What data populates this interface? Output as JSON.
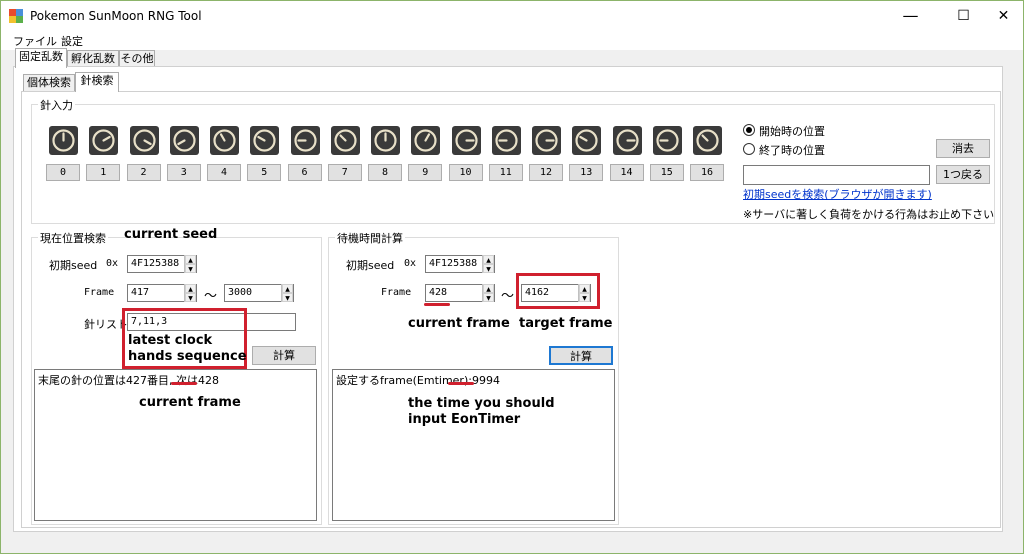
{
  "window": {
    "title": "Pokemon SunMoon RNG Tool",
    "minimize": "—",
    "maximize": "☐",
    "close": "✕"
  },
  "menu": [
    "ファイル",
    "設定"
  ],
  "tabs_top": [
    "固定乱数",
    "孵化乱数",
    "その他"
  ],
  "tabs_sub": [
    "個体検索",
    "針検索"
  ],
  "needle_input": {
    "label": "針入力",
    "buttons": [
      "0",
      "1",
      "2",
      "3",
      "4",
      "5",
      "6",
      "7",
      "8",
      "9",
      "10",
      "11",
      "12",
      "13",
      "14",
      "15",
      "16"
    ],
    "radio_start": "開始時の位置",
    "radio_end": "終了時の位置",
    "clear": "消去",
    "back": "1つ戻る",
    "search_link": "初期seedを検索(ブラウザが開きます)",
    "notice": "※サーバに著しく負荷をかける行為はお止め下さい"
  },
  "position_search": {
    "label": "現在位置検索",
    "initial_seed_label": "初期seed",
    "hex_prefix": "0x",
    "initial_seed": "4F125388",
    "frame_label": "Frame",
    "frame_from": "417",
    "tilde": "〜",
    "frame_to": "3000",
    "needle_list_label": "針リスト",
    "needle_list": "7,11,3",
    "calc": "計算",
    "result": "末尾の針の位置は427番目, 次は428"
  },
  "wait_calc": {
    "label": "待機時間計算",
    "initial_seed_label": "初期seed",
    "hex_prefix": "0x",
    "initial_seed": "4F125388",
    "frame_label": "Frame",
    "frame_from": "428",
    "tilde": "〜",
    "frame_to": "4162",
    "calc": "計算",
    "result": "設定するframe(Emtimer):9994"
  },
  "annotations": {
    "current_seed": "current seed",
    "latest_clock_1": "latest clock",
    "latest_clock_2": "hands sequence",
    "current_frame_left": "current frame",
    "current_frame_right": "current frame",
    "target_frame": "target frame",
    "eontimer_1": "the time you should",
    "eontimer_2": "input EonTimer"
  },
  "colors": {
    "annotation_red": "#d0202e",
    "link_blue": "#0033cc",
    "window_border": "#8cb46a"
  }
}
